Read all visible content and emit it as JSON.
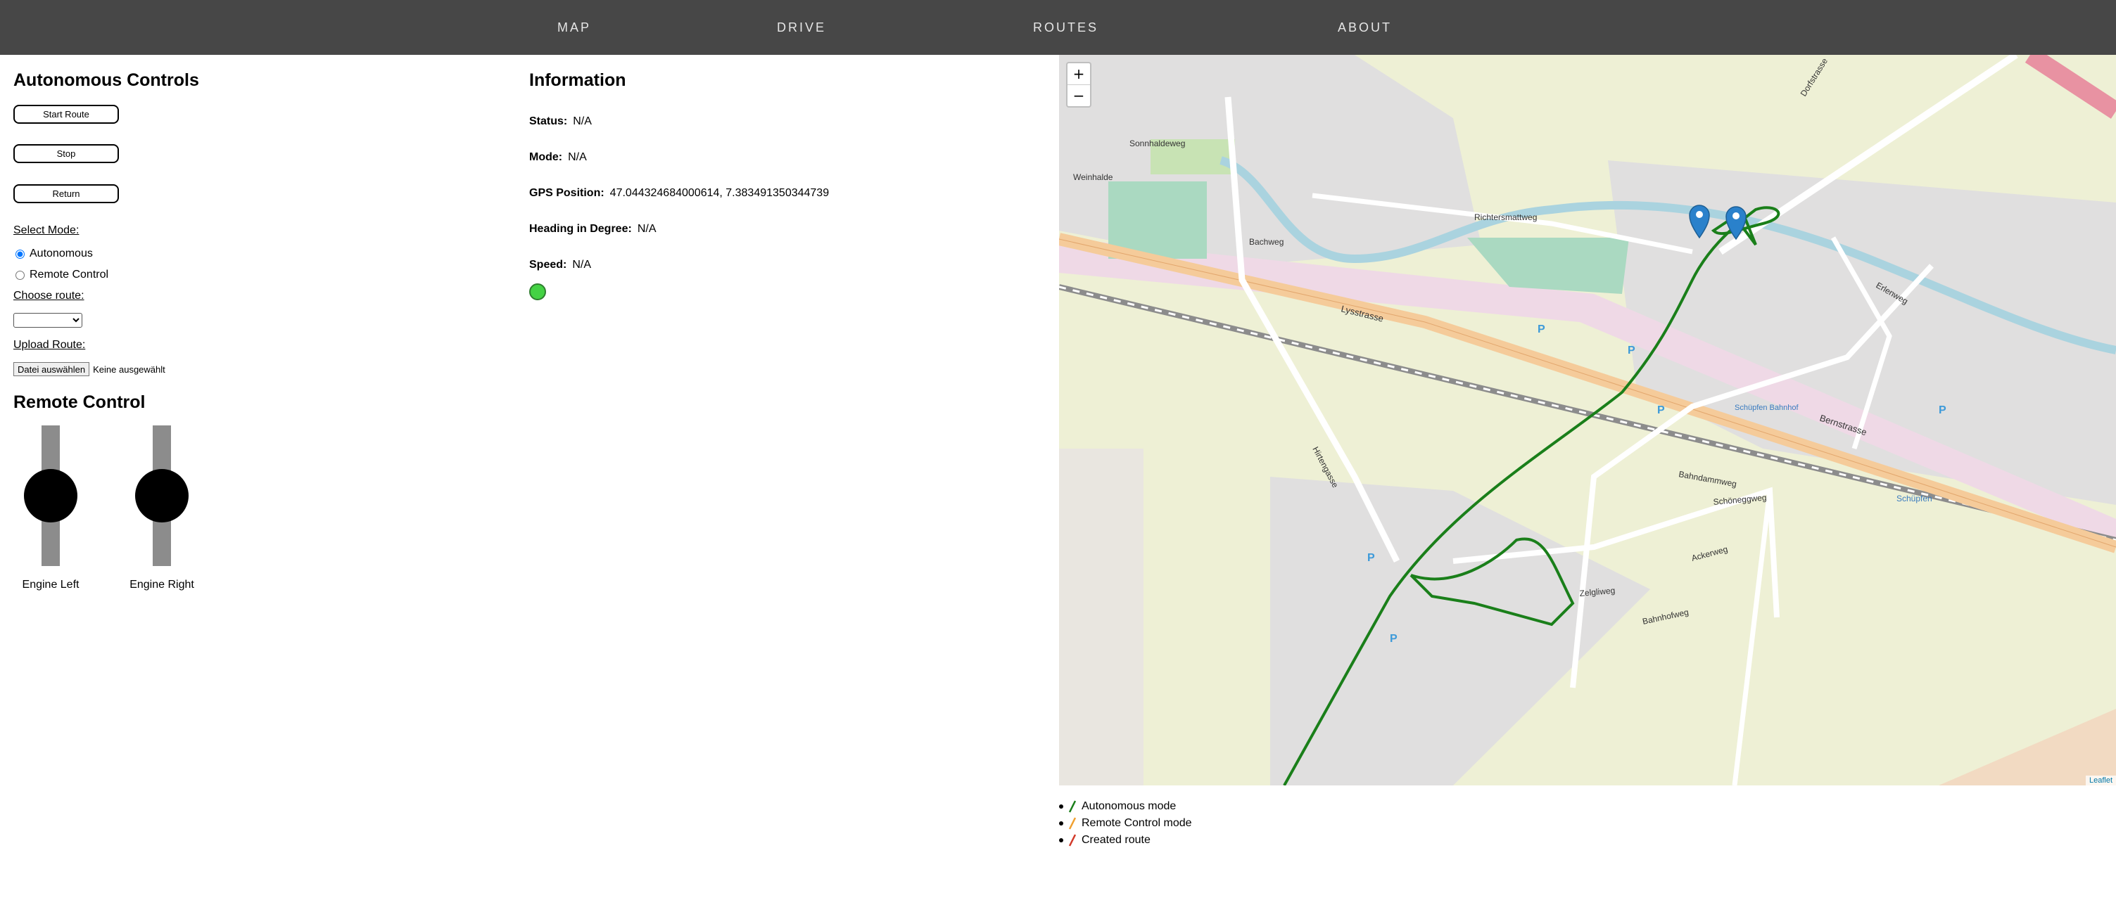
{
  "nav": {
    "items": [
      "MAP",
      "DRIVE",
      "ROUTES",
      "ABOUT"
    ]
  },
  "autonomous": {
    "title": "Autonomous Controls",
    "start_label": "Start Route",
    "stop_label": "Stop",
    "return_label": "Return",
    "select_mode_label": "Select Mode:",
    "mode_options": [
      "Autonomous",
      "Remote Control"
    ],
    "selected_mode": "Autonomous",
    "choose_route_label": "Choose route:",
    "route_selected": "",
    "upload_label": "Upload Route:",
    "file_button": "Datei auswählen",
    "file_status": "Keine ausgewählt"
  },
  "remote": {
    "title": "Remote Control",
    "engine_left_label": "Engine Left",
    "engine_right_label": "Engine Right",
    "engine_left_level": 0.5,
    "engine_right_level": 0.5
  },
  "info": {
    "title": "Information",
    "status_key": "Status:",
    "status_val": "N/A",
    "mode_key": "Mode:",
    "mode_val": "N/A",
    "gps_key": "GPS Position:",
    "gps_val": "47.044324684000614, 7.383491350344739",
    "heading_key": "Heading in Degree:",
    "heading_val": "N/A",
    "speed_key": "Speed:",
    "speed_val": "N/A",
    "indicator_color": "#44d244"
  },
  "map": {
    "zoom_in": "+",
    "zoom_out": "−",
    "attribution": "Leaflet",
    "street_labels": [
      "Lysstrasse",
      "Bernstrasse",
      "Bahndammweg",
      "Richtersmattweg",
      "Bachweg",
      "Sonnhaldeweg",
      "Weinhalde",
      "Hirtengasse",
      "Schöneggweg",
      "Ackerweg",
      "Bahnhofweg",
      "Zelgliweg",
      "Erlenweg",
      "Dorfstrasse"
    ],
    "place_labels": [
      "Schüpfen Bahnhof",
      "Schüpfen"
    ],
    "track_color": "#1a7f1a",
    "marker_color": "#2a81cb"
  },
  "legend": {
    "items": [
      {
        "label": "Autonomous mode",
        "color": "#1a7f1a"
      },
      {
        "label": "Remote Control mode",
        "color": "#f0a030"
      },
      {
        "label": "Created route",
        "color": "#d23a2a"
      }
    ]
  }
}
